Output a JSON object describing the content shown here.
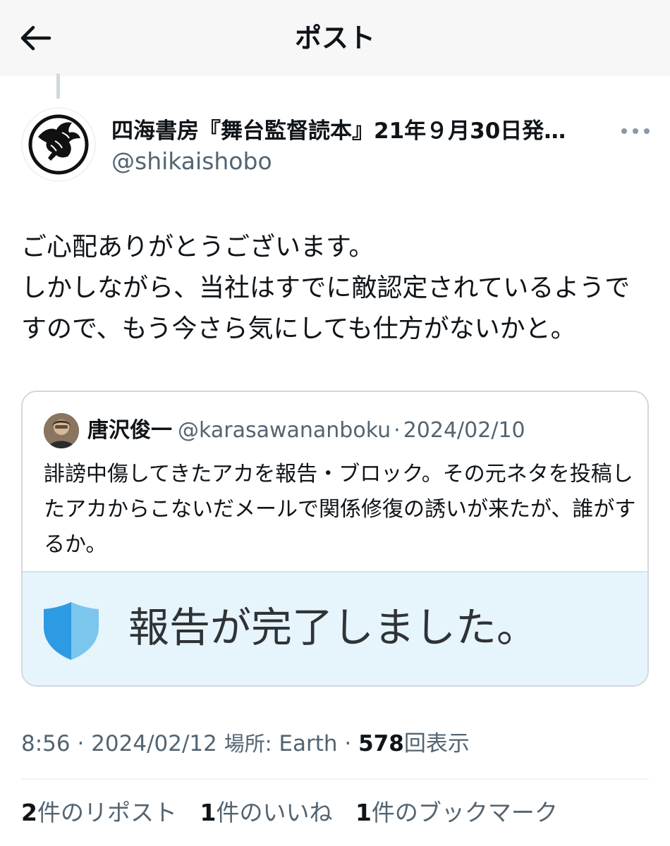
{
  "header": {
    "title": "ポスト",
    "back_icon": "arrow-left-icon"
  },
  "post": {
    "author": {
      "name": "四海書房『舞台監督読本』21年９月30日発…",
      "handle": "@shikaishobo",
      "avatar_icon": "eagle-logo"
    },
    "more_icon": "more-horizontal-icon",
    "text": "ご心配ありがとうございます。\nしかしながら、当社はすでに敵認定されているようですので、もう今さら気にしても仕方がないかと。",
    "quote": {
      "name": "唐沢俊一",
      "handle": "@karasawananboku",
      "separator": "·",
      "date": "2024/02/10",
      "text": "誹謗中傷してきたアカを報告・ブロック。その元ネタを投稿したアカからこないだメールで関係修復の誘いが来たが、誰がするか。",
      "media_text": "報告が完了しました。",
      "media_icon": "shield-icon"
    },
    "meta": {
      "time": "8:56",
      "sep1": "·",
      "date": "2024/02/12",
      "place_label": "場所:",
      "place": "Earth",
      "sep2": "·",
      "views": "578",
      "views_label": "回表示"
    },
    "stats": {
      "reposts": "2",
      "reposts_label": "件のリポスト",
      "likes": "1",
      "likes_label": "件のいいね",
      "bookmarks": "1",
      "bookmarks_label": "件のブックマーク"
    }
  },
  "colors": {
    "text_primary": "#0f1419",
    "text_secondary": "#536471",
    "border": "#cfd9de",
    "media_bg": "#e6f4fb",
    "shield_light": "#7cc6ee",
    "shield_dark": "#2d9be3"
  }
}
